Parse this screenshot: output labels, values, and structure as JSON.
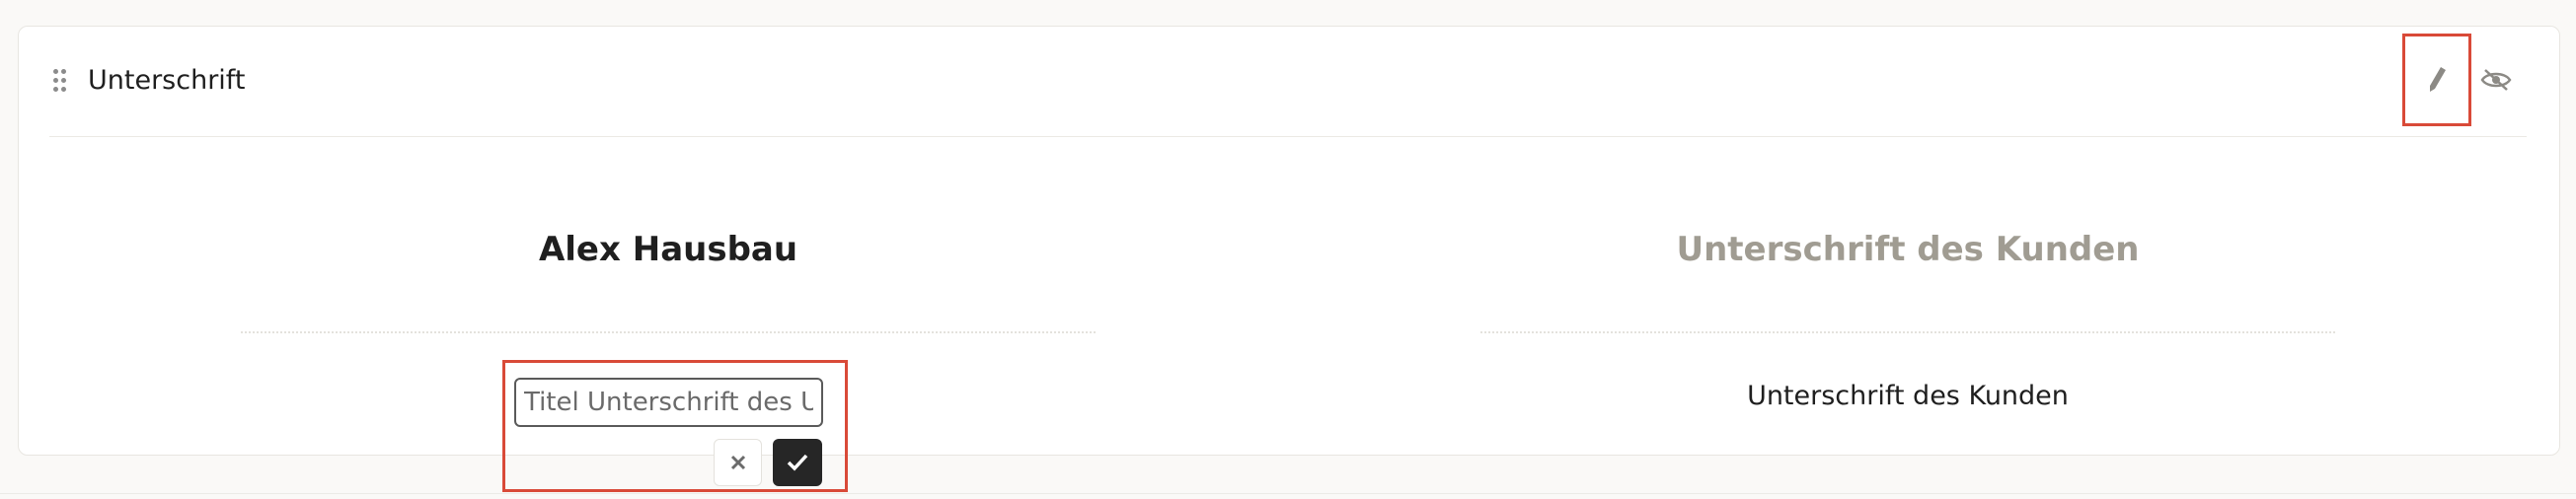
{
  "section": {
    "title": "Unterschrift",
    "edit_icon": "pencil-icon",
    "hide_icon": "eye-off-icon",
    "drag_icon": "drag-handle-icon"
  },
  "signature_left": {
    "name": "Alex Hausbau",
    "title_input_value": "",
    "title_input_placeholder": "Titel Unterschrift des U",
    "cancel_icon": "close-icon",
    "confirm_icon": "check-icon"
  },
  "signature_right": {
    "name": "Unterschrift des Kunden",
    "caption": "Unterschrift des Kunden"
  },
  "colors": {
    "highlight": "#d94a38",
    "muted_text": "#a09c92",
    "dark_button": "#262626"
  }
}
